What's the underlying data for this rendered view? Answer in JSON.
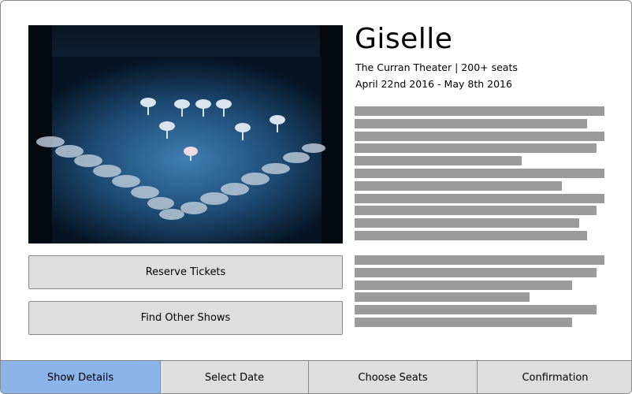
{
  "show": {
    "title": "Giselle",
    "venue_line": "The Curran Theater | 200+ seats",
    "dates_line": "April 22nd 2016 - May 8th 2016"
  },
  "actions": {
    "reserve_label": "Reserve Tickets",
    "find_label": "Find Other Shows"
  },
  "description_placeholder": {
    "paragraph_1_line_fractions": [
      1.0,
      0.93,
      1.0,
      0.97,
      0.67,
      1.0,
      0.83,
      1.0,
      0.97,
      0.9,
      0.93
    ],
    "paragraph_2_line_fractions": [
      1.0,
      0.97,
      0.87,
      0.7,
      0.97,
      0.87
    ]
  },
  "tabs": [
    {
      "label": "Show Details",
      "active": true
    },
    {
      "label": "Select Date",
      "active": false
    },
    {
      "label": "Choose Seats",
      "active": false
    },
    {
      "label": "Confirmation",
      "active": false
    }
  ],
  "colors": {
    "active_tab": "#8cb3ea",
    "button_bg": "#dedede",
    "placeholder_bar": "#9b9b9b"
  }
}
